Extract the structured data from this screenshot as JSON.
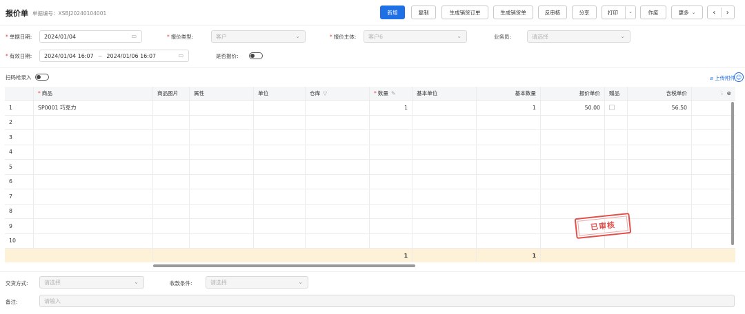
{
  "header": {
    "title": "报价单",
    "doc_no": "单据编号：XSBJ20240104001"
  },
  "toolbar": {
    "new": "新增",
    "copy": "复制",
    "gen_sales_order": "生成销货订单",
    "gen_sales_invoice": "生成销货单",
    "unaudit": "反审核",
    "share": "分享",
    "print": "打印",
    "void": "作废",
    "more": "更多",
    "prev": "‹",
    "next": "›"
  },
  "form": {
    "doc_date_label": "单据日期:",
    "doc_date": "2024/01/04",
    "quote_type_label": "报价类型:",
    "quote_type_placeholder": "客户",
    "quote_subject_label": "报价主体:",
    "quote_subject": "客户6",
    "salesman_label": "业务员:",
    "salesman_placeholder": "请选择",
    "valid_date_label": "有效日期:",
    "valid_from": "2024/01/04 16:07",
    "valid_sep": "~",
    "valid_to": "2024/01/06 16:07",
    "is_quoted_label": "是否报价:",
    "scan_label": "扫码枪录入",
    "attach": "上传附件"
  },
  "table": {
    "columns": [
      "",
      "商品",
      "商品图片",
      "属性",
      "单位",
      "仓库",
      "数量",
      "基本单位",
      "基本数量",
      "报价单价",
      "赠品",
      "含税单价",
      ""
    ],
    "rows": [
      {
        "no": "1",
        "product": "SP0001 巧克力",
        "qty": "1",
        "base_qty": "1",
        "price": "50.00",
        "tax_price": "56.50"
      },
      {
        "no": "2"
      },
      {
        "no": "3"
      },
      {
        "no": "4"
      },
      {
        "no": "5"
      },
      {
        "no": "6"
      },
      {
        "no": "7"
      },
      {
        "no": "8"
      },
      {
        "no": "9"
      },
      {
        "no": "10"
      }
    ],
    "total_qty": "1",
    "total_base_qty": "1"
  },
  "stamp": "已审核",
  "footer": {
    "delivery_label": "交货方式:",
    "delivery_placeholder": "请选择",
    "payment_label": "收款条件:",
    "payment_placeholder": "请选择",
    "remark_label": "备注:",
    "remark_placeholder": "请输入"
  },
  "colors": {
    "primary": "#1f6fe5",
    "required": "#e23b3b",
    "total_row": "#fdf1d8",
    "stamp": "#e2504c"
  }
}
